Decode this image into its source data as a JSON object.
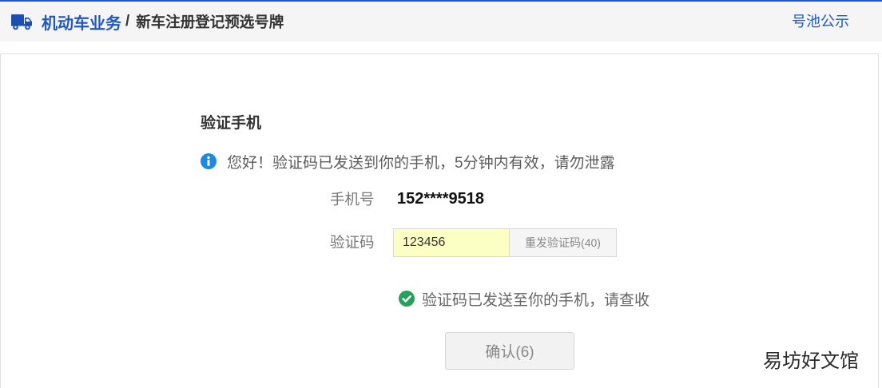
{
  "colors": {
    "top-bar": "#2059cf",
    "accent": "#1f58c2",
    "truck": "#1d4fb2",
    "info": "#1e88e5",
    "success": "#28a05b",
    "input-bg": "#fcffc4"
  },
  "icons": {
    "breadcrumb": "truck-icon",
    "notice": "info-icon",
    "success": "check-circle-icon"
  },
  "header": {
    "section_title": "机动车业务",
    "separator": "/",
    "page_title": "新车注册登记预选号牌",
    "pool_link": "号池公示"
  },
  "verify": {
    "title": "验证手机",
    "notice": "您好！验证码已发送到你的手机，5分钟内有效，请勿泄露",
    "phone_label": "手机号",
    "phone_value": "152****9518",
    "code_label": "验证码",
    "code_value": "123456",
    "resend_button": "重发验证码(40)",
    "success_message": "验证码已发送至你的手机，请查收",
    "confirm_button": "确认(6)"
  },
  "watermark": "易坊好文馆"
}
